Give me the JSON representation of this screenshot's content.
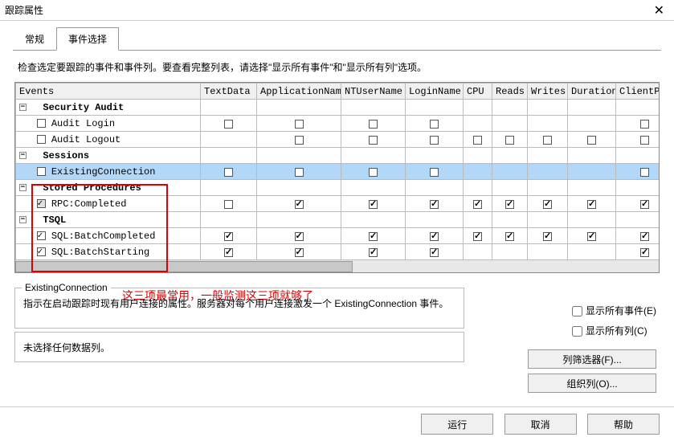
{
  "window": {
    "title": "跟踪属性",
    "close": "✕"
  },
  "tabs": {
    "general": "常规",
    "event_selection": "事件选择"
  },
  "instruction": "检查选定要跟踪的事件和事件列。要查看完整列表，请选择\"显示所有事件\"和\"显示所有列\"选项。",
  "columns": [
    "Events",
    "TextData",
    "ApplicationName",
    "NTUserName",
    "LoginName",
    "CPU",
    "Reads",
    "Writes",
    "Duration",
    "ClientProc"
  ],
  "groups": {
    "security_audit": "Security Audit",
    "sessions": "Sessions",
    "stored_procedures": "Stored Procedures",
    "tsql": "TSQL"
  },
  "events": {
    "audit_login": "Audit Login",
    "audit_logout": "Audit Logout",
    "existing_connection": "ExistingConnection",
    "rpc_completed": "RPC:Completed",
    "sql_batch_completed": "SQL:BatchCompleted",
    "sql_batch_starting": "SQL:BatchStarting"
  },
  "annotation": "这三项最常用，一般监测这三项就够了",
  "desc": {
    "legend": "ExistingConnection",
    "text": "指示在启动跟踪时现有用户连接的属性。服务器对每个用户连接激发一个 ExistingConnection 事件。"
  },
  "right_checks": {
    "show_all_events": "显示所有事件(E)",
    "show_all_columns": "显示所有列(C)"
  },
  "desc2": "未选择任何数据列。",
  "right_buttons": {
    "column_filter": "列筛选器(F)...",
    "organize_columns": "组织列(O)..."
  },
  "bottom": {
    "run": "运行",
    "cancel": "取消",
    "help": "帮助"
  }
}
